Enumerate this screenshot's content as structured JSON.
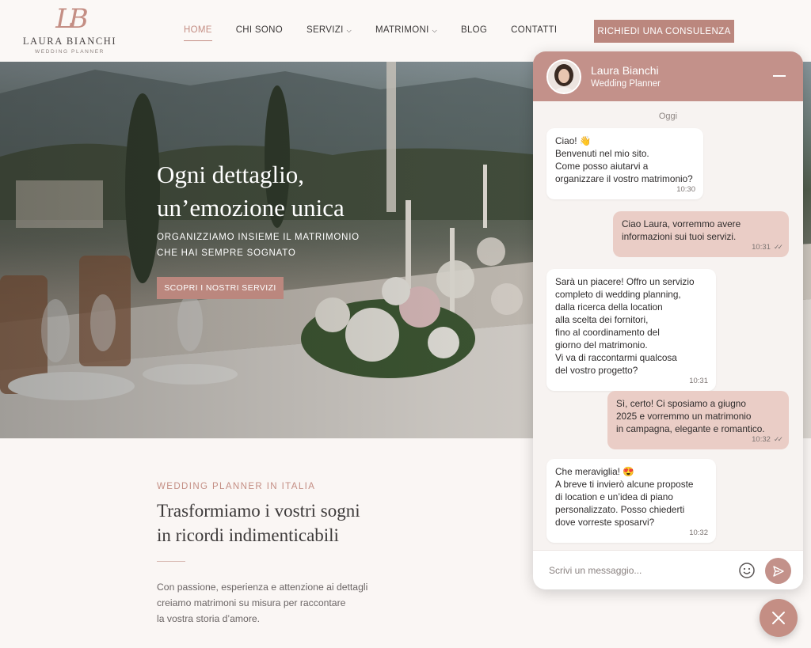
{
  "logo": {
    "mark": "LB",
    "name": "LAURA BIANCHI",
    "tagline": "WEDDING PLANNER"
  },
  "nav": {
    "items": [
      {
        "label": "HOME",
        "active": true,
        "dropdown": false
      },
      {
        "label": "CHI SONO",
        "active": false,
        "dropdown": false
      },
      {
        "label": "SERVIZI",
        "active": false,
        "dropdown": true
      },
      {
        "label": "MATRIMONI",
        "active": false,
        "dropdown": true
      },
      {
        "label": "BLOG",
        "active": false,
        "dropdown": false
      },
      {
        "label": "CONTATTI",
        "active": false,
        "dropdown": false
      }
    ],
    "cta": "RICHIEDI UNA CONSULENZA"
  },
  "hero": {
    "title_line1": "Ogni dettaglio,",
    "title_line2": "un’emozione unica",
    "subtitle_line1": "ORGANIZZIAMO INSIEME IL MATRIMONIO",
    "subtitle_line2": "CHE HAI SEMPRE SOGNATO",
    "button": "SCOPRI I NOSTRI SERVIZI"
  },
  "intro": {
    "kicker": "WEDDING PLANNER IN ITALIA",
    "title_line1": "Trasformiamo i vostri sogni",
    "title_line2": "in ricordi indimenticabili",
    "body_line1": "Con passione, esperienza e attenzione ai dettagli",
    "body_line2": "creiamo matrimoni su misura per raccontare",
    "body_line3": "la vostra storia d’amore."
  },
  "chat": {
    "name": "Laura Bianchi",
    "role": "Wedding Planner",
    "day_label": "Oggi",
    "messages": [
      {
        "from": "planner",
        "text": "Ciao! 👋\nBenvenuti nel mio sito.\nCome posso aiutarvi a\norganizzare il vostro matrimonio?",
        "time": "10:30"
      },
      {
        "from": "user",
        "text": "Ciao Laura, vorremmo avere\ninformazioni sui tuoi servizi.",
        "time": "10:31",
        "read": true
      },
      {
        "from": "planner",
        "text": "Sarà un piacere! Offro un servizio\ncompleto di wedding planning,\ndalla ricerca della location\nalla scelta dei fornitori,\nfino al coordinamento del\ngiorno del matrimonio.\nVi va di raccontarmi qualcosa\ndel vostro progetto?",
        "time": "10:31"
      },
      {
        "from": "user",
        "text": "Sì, certo! Ci sposiamo a giugno\n2025 e vorremmo un matrimonio\nin campagna, elegante e romantico.",
        "time": "10:32",
        "read": true
      },
      {
        "from": "planner",
        "text": "Che meraviglia! 😍\nA breve ti invierò alcune proposte\ndi location e un’idea di piano\npersonalizzato. Posso chiederti\ndove vorreste sposarvi?",
        "time": "10:32"
      }
    ],
    "input_placeholder": "Scrivi un messaggio..."
  },
  "colors": {
    "accent": "#bb877e",
    "chat_header": "#c3918a",
    "user_bubble": "#eacdc6"
  }
}
